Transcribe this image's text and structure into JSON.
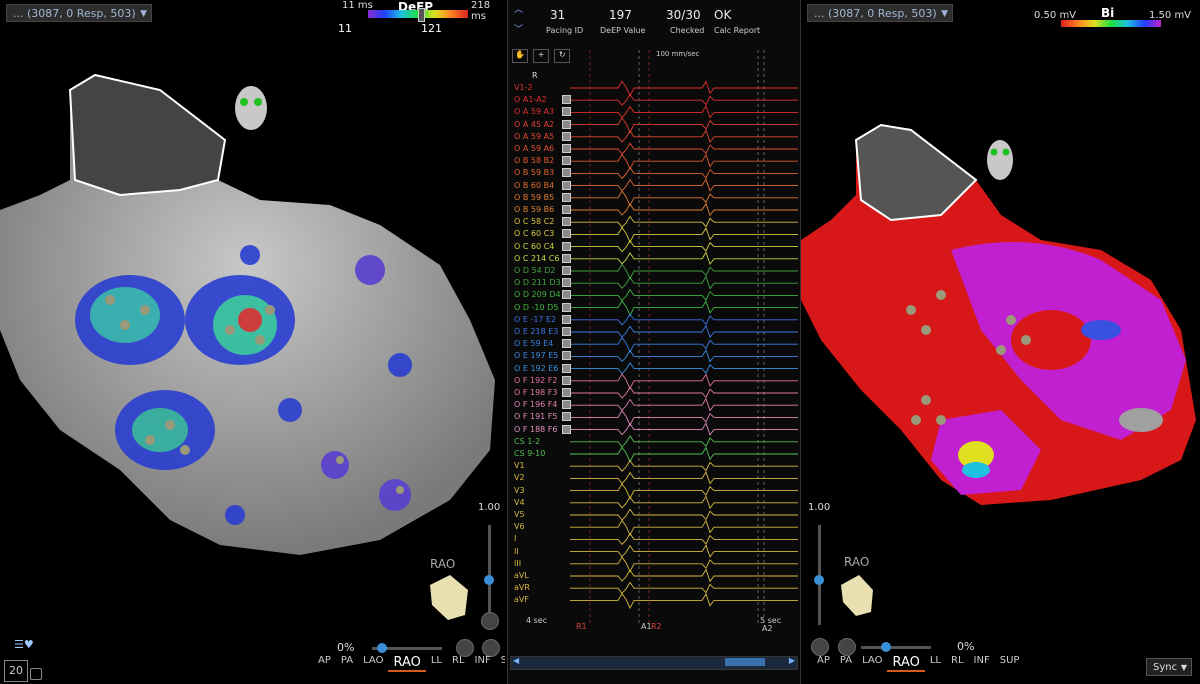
{
  "left_view": {
    "selector": "... (3087, 0 Resp, 503)",
    "colorbar": {
      "title": "DeEP",
      "min_label": "11 ms",
      "max_label": "218 ms",
      "low": "11",
      "high": "121"
    },
    "orientation": "RAO",
    "zoom": "1.00",
    "transparency": "0%",
    "projections": [
      "AP",
      "PA",
      "LAO",
      "RAO",
      "LL",
      "RL",
      "INF",
      "SUP"
    ],
    "active_projection": "RAO",
    "corner_counter": "20"
  },
  "right_view": {
    "selector": "... (3087, 0 Resp, 503)",
    "colorbar": {
      "title": "Bi",
      "min_label": "0.50 mV",
      "max_label": "1.50 mV"
    },
    "orientation": "RAO",
    "zoom": "1.00",
    "transparency": "0%",
    "projections": [
      "AP",
      "PA",
      "LAO",
      "RAO",
      "LL",
      "RL",
      "INF",
      "SUP"
    ],
    "active_projection": "RAO",
    "sync_label": "Sync"
  },
  "signals": {
    "header": [
      {
        "value": "31",
        "label": "Pacing ID"
      },
      {
        "value": "197",
        "label": "DeEP Value"
      },
      {
        "value": "30/30",
        "label": "Checked"
      },
      {
        "value": "OK",
        "label": "Calc Report"
      }
    ],
    "sweep_speed": "100 mm/sec",
    "ref_label": "R",
    "channels": [
      {
        "name": "V1-2",
        "prefix": "",
        "deep": "",
        "color": "#e03030"
      },
      {
        "name": "A1-A2",
        "prefix": "O",
        "deep": "",
        "color": "#e03030"
      },
      {
        "name": "A3",
        "prefix": "O A",
        "deep": "59",
        "color": "#e03030"
      },
      {
        "name": "A2",
        "prefix": "O A",
        "deep": "45",
        "color": "#e04030"
      },
      {
        "name": "A5",
        "prefix": "O A",
        "deep": "59",
        "color": "#e04a30"
      },
      {
        "name": "A6",
        "prefix": "O A",
        "deep": "59",
        "color": "#e05030"
      },
      {
        "name": "B2",
        "prefix": "O B",
        "deep": "58",
        "color": "#e05a30"
      },
      {
        "name": "B3",
        "prefix": "O B",
        "deep": "59",
        "color": "#e06430"
      },
      {
        "name": "B4",
        "prefix": "O B",
        "deep": "60",
        "color": "#e06e30"
      },
      {
        "name": "B5",
        "prefix": "O B",
        "deep": "59",
        "color": "#e07830"
      },
      {
        "name": "B6",
        "prefix": "O B",
        "deep": "59",
        "color": "#e08230"
      },
      {
        "name": "C2",
        "prefix": "O C",
        "deep": "58",
        "color": "#d8c040"
      },
      {
        "name": "C3",
        "prefix": "O C",
        "deep": "60",
        "color": "#d8c840"
      },
      {
        "name": "C4",
        "prefix": "O C",
        "deep": "60",
        "color": "#d0d040"
      },
      {
        "name": "C6",
        "prefix": "O C",
        "deep": "214",
        "color": "#c8d840"
      },
      {
        "name": "D2",
        "prefix": "O D",
        "deep": "54",
        "color": "#40a040"
      },
      {
        "name": "D3",
        "prefix": "O D",
        "deep": "211",
        "color": "#40a840"
      },
      {
        "name": "D4",
        "prefix": "O D",
        "deep": "209",
        "color": "#40b040"
      },
      {
        "name": "D5",
        "prefix": "O D",
        "deep": "-10",
        "color": "#40b840"
      },
      {
        "name": "E2",
        "prefix": "O E",
        "deep": "-17",
        "color": "#3a70e0"
      },
      {
        "name": "E3",
        "prefix": "O E",
        "deep": "218",
        "color": "#3a78e0"
      },
      {
        "name": "E4",
        "prefix": "O E",
        "deep": "59",
        "color": "#3a80e0"
      },
      {
        "name": "E5",
        "prefix": "O E",
        "deep": "197",
        "color": "#3a88e0"
      },
      {
        "name": "E6",
        "prefix": "O E",
        "deep": "192",
        "color": "#3a90e0"
      },
      {
        "name": "F2",
        "prefix": "O F",
        "deep": "192",
        "color": "#e070a0"
      },
      {
        "name": "F3",
        "prefix": "O F",
        "deep": "198",
        "color": "#e078a8"
      },
      {
        "name": "F4",
        "prefix": "O F",
        "deep": "196",
        "color": "#e080b0"
      },
      {
        "name": "F5",
        "prefix": "O F",
        "deep": "191",
        "color": "#e088b8"
      },
      {
        "name": "F6",
        "prefix": "O F",
        "deep": "188",
        "color": "#e090c0"
      },
      {
        "name": "CS 1-2",
        "prefix": "",
        "deep": "",
        "color": "#50c050"
      },
      {
        "name": "CS 9-10",
        "prefix": "",
        "deep": "",
        "color": "#50c050"
      },
      {
        "name": "V1",
        "prefix": "",
        "deep": "",
        "color": "#d8b840"
      },
      {
        "name": "V2",
        "prefix": "",
        "deep": "",
        "color": "#d8b840"
      },
      {
        "name": "V3",
        "prefix": "",
        "deep": "",
        "color": "#d8b840"
      },
      {
        "name": "V4",
        "prefix": "",
        "deep": "",
        "color": "#d8b840"
      },
      {
        "name": "V5",
        "prefix": "",
        "deep": "",
        "color": "#d8b840"
      },
      {
        "name": "V6",
        "prefix": "",
        "deep": "",
        "color": "#d8b840"
      },
      {
        "name": "I",
        "prefix": "",
        "deep": "",
        "color": "#d8b840"
      },
      {
        "name": "II",
        "prefix": "",
        "deep": "",
        "color": "#d8b840"
      },
      {
        "name": "III",
        "prefix": "",
        "deep": "",
        "color": "#d8b840"
      },
      {
        "name": "aVL",
        "prefix": "",
        "deep": "",
        "color": "#d8b840"
      },
      {
        "name": "aVR",
        "prefix": "",
        "deep": "",
        "color": "#d8b840"
      },
      {
        "name": "aVF",
        "prefix": "",
        "deep": "",
        "color": "#d8b840"
      }
    ],
    "footer": {
      "left_time": "4 sec",
      "right_time": "5 sec",
      "markers": [
        "R1",
        "A1",
        "R2",
        "A2"
      ]
    }
  },
  "colors": {
    "accent": "#d45a1e",
    "slider": "#3a8fd6",
    "panel_border": "#333333"
  }
}
